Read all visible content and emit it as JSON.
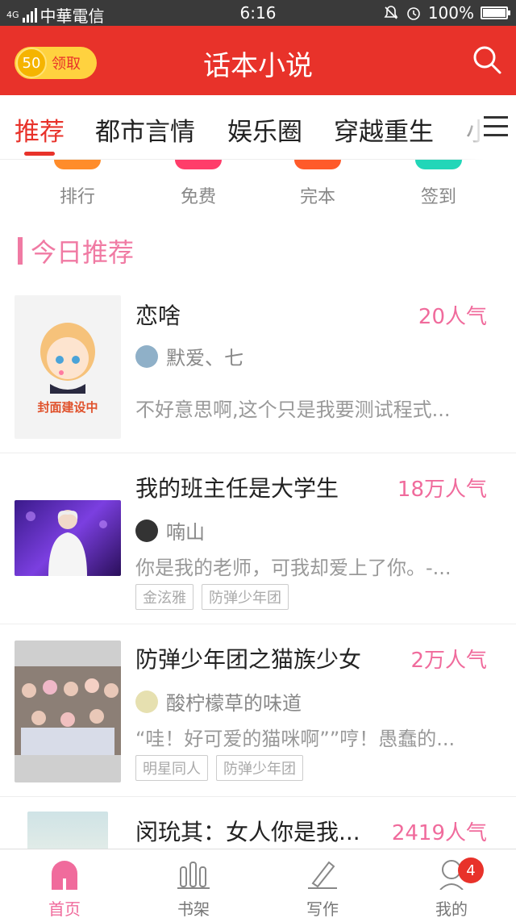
{
  "status_bar": {
    "carrier": "中華電信",
    "network": "4G",
    "time": "6:16",
    "battery": "100%",
    "battery_level": 1.0
  },
  "header": {
    "coin_count": "50",
    "coin_label": "领取",
    "title": "话本小说"
  },
  "tabs": [
    {
      "label": "推荐",
      "active": true
    },
    {
      "label": "都市言情",
      "active": false
    },
    {
      "label": "娱乐圈",
      "active": false
    },
    {
      "label": "穿越重生",
      "active": false
    },
    {
      "label": "小",
      "active": false
    }
  ],
  "quick_entries": [
    {
      "label": "排行",
      "color": "#ff8c2a"
    },
    {
      "label": "免费",
      "color": "#ff3d6a"
    },
    {
      "label": "完本",
      "color": "#ff5a2a"
    },
    {
      "label": "签到",
      "color": "#22d6b8"
    }
  ],
  "section": {
    "title": "今日推荐"
  },
  "books": [
    {
      "title": "恋啥",
      "popularity": "20人气",
      "author": "默爱、七",
      "description": "不好意思啊,这个只是我要测试程式...",
      "tags": [],
      "cover_placeholder": "封面建设中"
    },
    {
      "title": "我的班主任是大学生",
      "popularity": "18万人气",
      "author": "喃山",
      "description": "你是我的老师，可我却爱上了你。-...",
      "tags": [
        "金泫雅",
        "防弹少年团"
      ]
    },
    {
      "title": "防弹少年团之猫族少女",
      "popularity": "2万人气",
      "author": "酸柠檬草的味道",
      "description": "“哇！好可爱的猫咪啊””哼！愚蠢的...",
      "tags": [
        "明星同人",
        "防弹少年团"
      ]
    },
    {
      "title": "闵玧其：女人你是我...",
      "popularity": "2419人气"
    }
  ],
  "bottom_nav": [
    {
      "label": "首页",
      "active": true
    },
    {
      "label": "书架",
      "active": false
    },
    {
      "label": "写作",
      "active": false
    },
    {
      "label": "我的",
      "active": false,
      "badge": "4"
    }
  ],
  "colors": {
    "brand_red": "#e8322a",
    "accent_pink": "#f06b9c"
  }
}
